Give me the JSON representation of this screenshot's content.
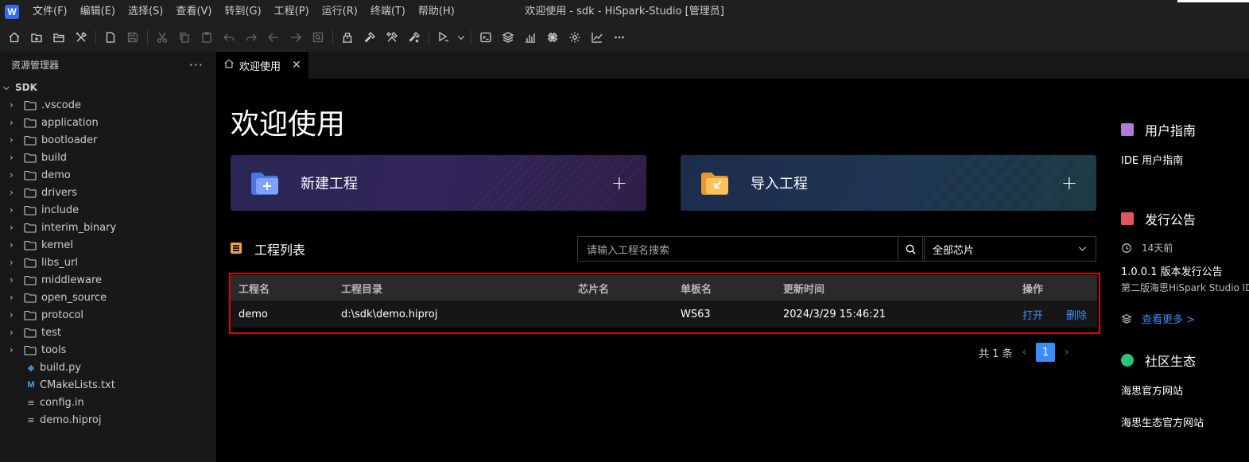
{
  "titlebar": {
    "window_title": "欢迎使用 - sdk - HiSpark-Studio [管理员]",
    "menu": [
      "文件(F)",
      "编辑(E)",
      "选择(S)",
      "查看(V)",
      "转到(G)",
      "工程(P)",
      "运行(R)",
      "终端(T)",
      "帮助(H)"
    ]
  },
  "sidebar": {
    "title": "资源管理器",
    "more": "···",
    "root": "SDK",
    "folders": [
      ".vscode",
      "application",
      "bootloader",
      "build",
      "demo",
      "drivers",
      "include",
      "interim_binary",
      "kernel",
      "libs_url",
      "middleware",
      "open_source",
      "protocol",
      "test",
      "tools"
    ],
    "files": [
      {
        "name": "build.py",
        "icon": "python-icon"
      },
      {
        "name": "CMakeLists.txt",
        "icon": "cmake-icon"
      },
      {
        "name": "config.in",
        "icon": "text-file-icon"
      },
      {
        "name": "demo.hiproj",
        "icon": "text-file-icon"
      }
    ]
  },
  "tab": {
    "label": "欢迎使用",
    "close": "✕"
  },
  "main": {
    "title": "欢迎使用",
    "new_project": "新建工程",
    "import_project": "导入工程",
    "plus": "+",
    "list_title": "工程列表",
    "search_placeholder": "请输入工程名搜索",
    "chip_filter": "全部芯片",
    "table": {
      "headers": [
        "工程名",
        "工程目录",
        "芯片名",
        "单板名",
        "更新时间",
        "操作"
      ],
      "rows": [
        {
          "name": "demo",
          "dir": "d:\\sdk\\demo.hiproj",
          "chip": "",
          "board": "WS63",
          "updated": "2024/3/29 15:46:21",
          "open": "打开",
          "delete": "删除"
        }
      ]
    },
    "pager": {
      "total": "共 1 条",
      "page": "1"
    }
  },
  "right_panel": {
    "guide_title": "用户指南",
    "guide_link": "IDE 用户指南",
    "release_title": "发行公告",
    "release_time": "14天前",
    "release_version": "1.0.0.1 版本发行公告",
    "release_desc": "第二版海思HiSpark Studio IDE",
    "see_more": "查看更多 >",
    "community_title": "社区生态",
    "community_links": [
      "海思官方网站",
      "海思生态官方网站"
    ]
  },
  "colors": {
    "accent": "#3b8cf6",
    "highlight_box": "#e0000b",
    "list_icon": "#f0a53b"
  }
}
